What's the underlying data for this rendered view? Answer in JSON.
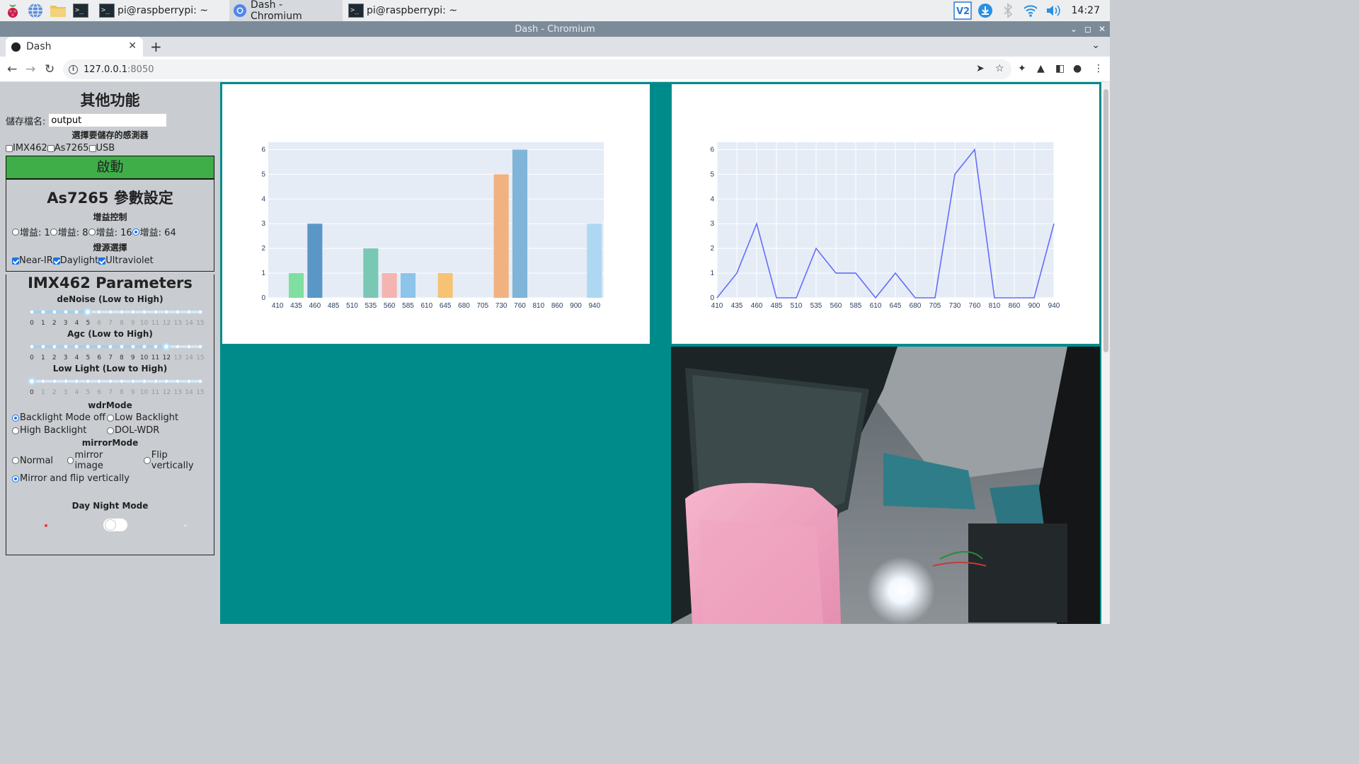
{
  "taskbar": {
    "tasks": [
      {
        "label": "pi@raspberrypi: ~",
        "icon": "terminal-icon"
      },
      {
        "label": "Dash - Chromium",
        "icon": "chromium-icon"
      },
      {
        "label": "pi@raspberrypi: ~",
        "icon": "terminal-icon"
      }
    ],
    "clock": "14:27"
  },
  "window": {
    "title": "Dash - Chromium"
  },
  "browser": {
    "tab_title": "Dash",
    "url_host": "127.0.0.1",
    "url_port": ":8050"
  },
  "sidebar": {
    "other_title": "其他功能",
    "filename_label": "儲存檔名:",
    "filename_value": "output",
    "select_sensor_label": "選擇要儲存的感測器",
    "sensors": [
      {
        "label": "IMX462",
        "checked": false
      },
      {
        "label": "As7265",
        "checked": false
      },
      {
        "label": "USB",
        "checked": false
      }
    ],
    "start_label": "啟動",
    "as7265": {
      "title": "As7265 參數設定",
      "gain_label": "增益控制",
      "gains": [
        {
          "label": "增益: 1",
          "selected": false
        },
        {
          "label": "增益: 8",
          "selected": false
        },
        {
          "label": "增益: 16",
          "selected": false
        },
        {
          "label": "增益: 64",
          "selected": true
        }
      ],
      "light_label": "燈源選擇",
      "lights": [
        {
          "label": "Near-IR",
          "checked": true
        },
        {
          "label": "Daylight",
          "checked": true
        },
        {
          "label": "Ultraviolet",
          "checked": true
        }
      ]
    },
    "imx462": {
      "title": "IMX462 Parameters",
      "sliders": [
        {
          "label": "deNoise (Low to High)",
          "value": 5
        },
        {
          "label": "Agc (Low to High)",
          "value": 12
        },
        {
          "label": "Low Light (Low to High)",
          "value": 0
        }
      ],
      "slider_marks": [
        "0",
        "1",
        "2",
        "3",
        "4",
        "5",
        "6",
        "7",
        "8",
        "9",
        "10",
        "11",
        "12",
        "13",
        "14",
        "15"
      ],
      "wdr_label": "wdrMode",
      "wdr_options": [
        {
          "label": "Backlight Mode off",
          "selected": true
        },
        {
          "label": "Low Backlight",
          "selected": false
        },
        {
          "label": "High Backlight",
          "selected": false
        },
        {
          "label": "DOL-WDR",
          "selected": false
        }
      ],
      "mirror_label": "mirrorMode",
      "mirror_options": [
        {
          "label": "Normal",
          "selected": false
        },
        {
          "label": "mirror image",
          "selected": false
        },
        {
          "label": "Flip vertically",
          "selected": false
        },
        {
          "label": "Mirror and flip vertically",
          "selected": true
        }
      ],
      "daynight_label": "Day Night Mode",
      "daynight_on": false
    }
  },
  "chart_data": [
    {
      "type": "bar",
      "categories": [
        "410",
        "435",
        "460",
        "485",
        "510",
        "535",
        "560",
        "585",
        "610",
        "645",
        "680",
        "705",
        "730",
        "760",
        "810",
        "860",
        "900",
        "940"
      ],
      "values": [
        0,
        1,
        3,
        0,
        0,
        2,
        1,
        1,
        0,
        1,
        0,
        0,
        5,
        6,
        0,
        0,
        0,
        3
      ],
      "colors": [
        "#7fdfa0",
        "#7fdfa0",
        "#5b97c6",
        "#5b97c6",
        "#5b97c6",
        "#78c8b4",
        "#f4b4b0",
        "#8cc4ea",
        "#8cc4ea",
        "#f6c274",
        "#f6c274",
        "#f6c274",
        "#f0b27e",
        "#80b4d8",
        "#80b4d8",
        "#80b4d8",
        "#80b4d8",
        "#aed8f2"
      ],
      "yticks": [
        0,
        1,
        2,
        3,
        4,
        5,
        6
      ],
      "ylim": [
        0,
        6.3
      ]
    },
    {
      "type": "line",
      "categories": [
        "410",
        "435",
        "460",
        "485",
        "510",
        "535",
        "560",
        "585",
        "610",
        "645",
        "680",
        "705",
        "730",
        "760",
        "810",
        "860",
        "900",
        "940"
      ],
      "values": [
        0,
        1,
        3,
        0,
        0,
        2,
        1,
        1,
        0,
        1,
        0,
        0,
        5,
        6,
        0,
        0,
        0,
        3
      ],
      "line_color": "#636efa",
      "yticks": [
        0,
        1,
        2,
        3,
        4,
        5,
        6
      ],
      "ylim": [
        0,
        6.3
      ]
    }
  ]
}
